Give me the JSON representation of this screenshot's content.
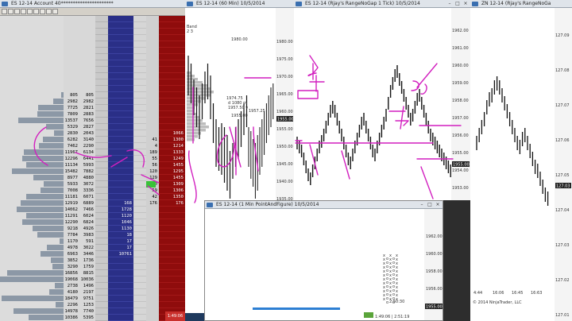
{
  "dom": {
    "title": "ES 12-14   Account 40",
    "title_masked": "**********************",
    "rows": [
      {
        "pc": "",
        "v": "",
        "p": "",
        "b": "",
        "l": "",
        "a": ""
      },
      {
        "pc": "",
        "v": "",
        "p": "",
        "b": "",
        "l": "",
        "a": ""
      },
      {
        "pc": "",
        "v": "",
        "p": "",
        "b": "",
        "l": "",
        "a": ""
      },
      {
        "pc": "",
        "v": "",
        "p": "",
        "b": "",
        "l": "",
        "a": ""
      },
      {
        "pc": "",
        "v": "",
        "p": "",
        "b": "",
        "l": "",
        "a": ""
      },
      {
        "pc": "",
        "v": "",
        "p": "",
        "b": "",
        "l": "",
        "a": ""
      },
      {
        "pc": "",
        "v": "",
        "p": "",
        "b": "",
        "l": "",
        "a": ""
      },
      {
        "pc": "",
        "v": "",
        "p": "",
        "b": "",
        "l": "",
        "a": ""
      },
      {
        "pc": "",
        "v": "",
        "p": "",
        "b": "",
        "l": "",
        "a": ""
      },
      {
        "pc": "",
        "v": "",
        "p": "",
        "b": "",
        "l": "",
        "a": ""
      },
      {
        "pc": "",
        "v": "",
        "p": "",
        "b": "",
        "l": "",
        "a": ""
      },
      {
        "pc": "",
        "v": "",
        "p": "",
        "b": "",
        "l": "",
        "a": ""
      },
      {
        "pc": "805",
        "v": "805",
        "p": "",
        "b": "",
        "l": "",
        "a": ""
      },
      {
        "pc": "2982",
        "v": "2982",
        "p": "",
        "b": "",
        "l": "",
        "a": ""
      },
      {
        "pc": "7725",
        "v": "2821",
        "p": "",
        "b": "",
        "l": "",
        "a": ""
      },
      {
        "pc": "7809",
        "v": "2883",
        "p": "",
        "b": "",
        "l": "",
        "a": ""
      },
      {
        "pc": "13537",
        "v": "7656",
        "p": "",
        "b": "",
        "l": "",
        "a": ""
      },
      {
        "pc": "5329",
        "v": "2827",
        "p": "",
        "b": "",
        "l": "",
        "a": ""
      },
      {
        "pc": "2830",
        "v": "2043",
        "p": "",
        "b": "",
        "l": "",
        "a": ""
      },
      {
        "pc": "6282",
        "v": "3140",
        "p": "",
        "b": "",
        "l": "",
        "a": ""
      },
      {
        "pc": "7462",
        "v": "2290",
        "p": "",
        "b": "",
        "l": "",
        "a": ""
      },
      {
        "pc": "11967",
        "v": "6134",
        "p": "",
        "b": "",
        "l": "",
        "a": ""
      },
      {
        "pc": "12296",
        "v": "6441",
        "p": "",
        "b": "",
        "l": "",
        "a": ""
      },
      {
        "pc": "11134",
        "v": "5993",
        "p": "",
        "b": "",
        "l": "",
        "a": ""
      },
      {
        "pc": "15482",
        "v": "7882",
        "p": "",
        "b": "",
        "l": "",
        "a": ""
      },
      {
        "pc": "8977",
        "v": "4880",
        "p": "",
        "b": "",
        "l": "",
        "a": ""
      },
      {
        "pc": "5933",
        "v": "3072",
        "p": "",
        "b": "",
        "l": "",
        "a": ""
      },
      {
        "pc": "7008",
        "v": "3336",
        "p": "",
        "b": "",
        "l": "",
        "a": ""
      },
      {
        "pc": "11181",
        "v": "6071",
        "p": "",
        "b": "",
        "l": "",
        "a": ""
      },
      {
        "pc": "12919",
        "v": "6889",
        "p": "",
        "b": "",
        "l": "",
        "a": ""
      },
      {
        "pc": "14062",
        "v": "7466",
        "p": "",
        "b": "",
        "l": "",
        "a": ""
      },
      {
        "pc": "11291",
        "v": "6024",
        "p": "",
        "b": "",
        "l": "",
        "a": ""
      },
      {
        "pc": "12290",
        "v": "6824",
        "p": "",
        "b": "",
        "l": "",
        "a": ""
      },
      {
        "pc": "9218",
        "v": "4926",
        "p": "",
        "b": "",
        "l": "",
        "a": ""
      },
      {
        "pc": "7784",
        "v": "3983",
        "p": "",
        "b": "",
        "l": "",
        "a": ""
      },
      {
        "pc": "1170",
        "v": "591",
        "p": "",
        "b": "",
        "l": "",
        "a": ""
      },
      {
        "pc": "4978",
        "v": "3022",
        "p": "",
        "b": "",
        "l": "",
        "a": ""
      },
      {
        "pc": "6963",
        "v": "3446",
        "p": "",
        "b": "",
        "l": "",
        "a": ""
      },
      {
        "pc": "3852",
        "v": "1736",
        "p": "",
        "b": "",
        "l": "",
        "a": ""
      },
      {
        "pc": "3290",
        "v": "1759",
        "p": "",
        "b": "",
        "l": "",
        "a": ""
      },
      {
        "pc": "16856",
        "v": "8815",
        "p": "",
        "b": "",
        "l": "",
        "a": ""
      },
      {
        "pc": "19068",
        "v": "10036",
        "p": "",
        "b": "",
        "l": "",
        "a": ""
      },
      {
        "pc": "2738",
        "v": "1496",
        "p": "",
        "b": "",
        "l": "",
        "a": ""
      },
      {
        "pc": "4180",
        "v": "2197",
        "p": "",
        "b": "",
        "l": "",
        "a": ""
      },
      {
        "pc": "18479",
        "v": "9751",
        "p": "",
        "b": "",
        "l": "",
        "a": ""
      },
      {
        "pc": "2296",
        "v": "1253",
        "p": "",
        "b": "",
        "l": "",
        "a": ""
      },
      {
        "pc": "14978",
        "v": "7740",
        "p": "",
        "b": "",
        "l": "",
        "a": ""
      },
      {
        "pc": "10386",
        "v": "5395",
        "p": "",
        "b": "",
        "l": "",
        "a": ""
      },
      {
        "pc": "9616",
        "v": "4864",
        "p": "",
        "b": "",
        "l": "",
        "a": ""
      }
    ],
    "bid_col": [
      "",
      "",
      "",
      "",
      "",
      "",
      "",
      "",
      "",
      "",
      "",
      "",
      "",
      "",
      "",
      "",
      "",
      "",
      "",
      "",
      "",
      "",
      "",
      "",
      "",
      "",
      "",
      "",
      "",
      "",
      "",
      "",
      "",
      "",
      "",
      "",
      "",
      "",
      "",
      "",
      "",
      "",
      "",
      "",
      "",
      "",
      "",
      ""
    ],
    "buy_marks": [
      "41",
      "4",
      "189",
      "55",
      "56",
      "120",
      "129",
      "70",
      "59",
      "42",
      "176"
    ],
    "sell_marks": [
      "1066",
      "1300",
      "1214",
      "1333",
      "1249",
      "1455",
      "1295",
      "1455",
      "1309",
      "1306",
      "1350",
      "176"
    ],
    "bid_sizes": [
      "168",
      "1728",
      "1120",
      "1046",
      "1130",
      "18",
      "17",
      "17",
      "10761"
    ],
    "bottom_status": "1:49:06",
    "colors": {
      "bid": "#2a2f87",
      "ask": "#8f0c0c",
      "buy": "#e8e8e8",
      "ink": "#d21fbf"
    }
  },
  "chart1": {
    "title": "ES 12-14 (60 Min)  10/5/2014",
    "label_top": "Band",
    "label_top2": "2 3",
    "prices": [
      "1980.00",
      "1975.00",
      "1970.00",
      "1965.00",
      "1960.00",
      "1955.00",
      "1950.00",
      "1945.00",
      "1940.00",
      "1935.00",
      "1930.00"
    ],
    "anno1": "1980.00",
    "anno2": "1974.75",
    "anno3": "d 1080 m",
    "anno4": "1957.50 v",
    "anno5": "1955.00",
    "anno6": "1957.25",
    "last": "1955.00"
  },
  "chart2": {
    "title": "ES 12-14  (Rjay's RangeNoGap  1 Tick)  10/5/2014",
    "prices": [
      "1962.00",
      "1961.00",
      "1960.00",
      "1959.00",
      "1958.00",
      "1957.00",
      "1956.00",
      "1955.00",
      "1954.00",
      "1953.00"
    ],
    "last": "1955.00"
  },
  "chart3": {
    "title": "ZN 12-14 (Rjay's RangeNoGa",
    "prices": [
      "127.09",
      "127.08",
      "127.07",
      "127.06",
      "127.05",
      "127.04",
      "127.03",
      "127.02",
      "127.01"
    ],
    "times": [
      "4:44",
      "16:06",
      "16:45",
      "16:63"
    ],
    "footer": "© 2014 NinjaTrader, LLC",
    "last": "127.03"
  },
  "chart4": {
    "title": "ES 12-14 (1 Min PointAndFigure)  10/5/2014",
    "prices": [
      "1962.00",
      "1960.00",
      "1958.00",
      "1956.00",
      "1954.00"
    ],
    "time1": "2:50:30",
    "time2": "1:49:06 | 2:51:19",
    "last": "1955.00"
  }
}
